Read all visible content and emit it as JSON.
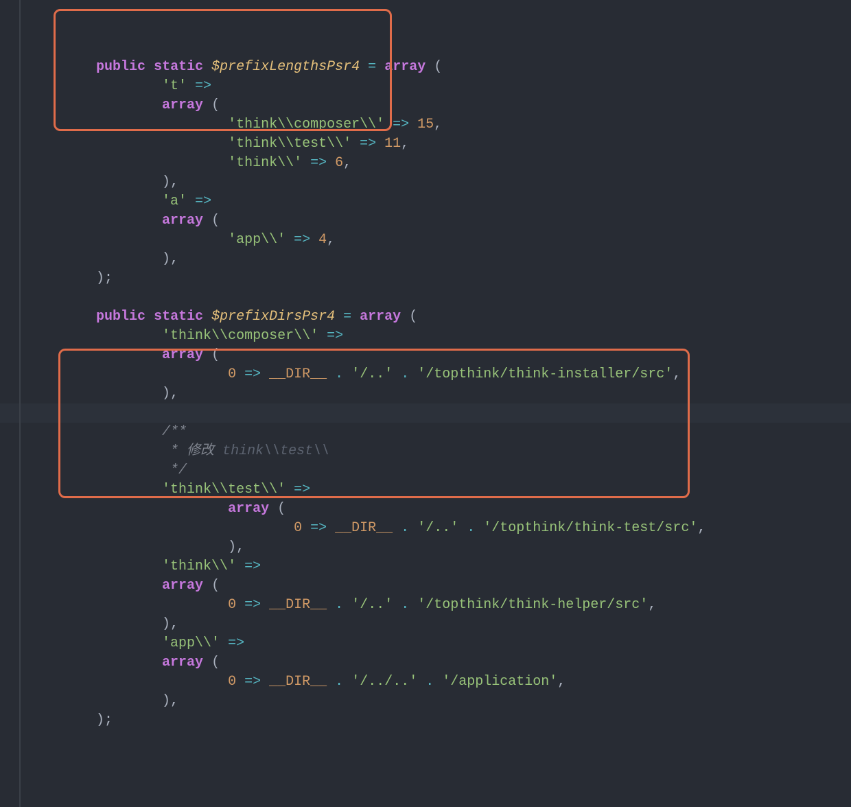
{
  "code": {
    "lines": [
      {
        "indent": 2,
        "tokens": [
          [
            "kw-public",
            "public"
          ],
          [
            "punct",
            " "
          ],
          [
            "kw-static",
            "static"
          ],
          [
            "punct",
            " "
          ],
          [
            "var",
            "$prefixLengthsPsr4"
          ],
          [
            "punct",
            " "
          ],
          [
            "op",
            "="
          ],
          [
            "punct",
            " "
          ],
          [
            "kw-array",
            "array"
          ],
          [
            "punct",
            " ("
          ]
        ]
      },
      {
        "indent": 4,
        "tokens": [
          [
            "str",
            "'t'"
          ],
          [
            "punct",
            " "
          ],
          [
            "op",
            "=>"
          ]
        ]
      },
      {
        "indent": 4,
        "tokens": [
          [
            "kw-array",
            "array"
          ],
          [
            "punct",
            " ("
          ]
        ]
      },
      {
        "indent": 6,
        "tokens": [
          [
            "str",
            "'think\\\\composer\\\\'"
          ],
          [
            "punct",
            " "
          ],
          [
            "op",
            "=>"
          ],
          [
            "punct",
            " "
          ],
          [
            "num",
            "15"
          ],
          [
            "punct",
            ","
          ]
        ]
      },
      {
        "indent": 6,
        "tokens": [
          [
            "str",
            "'think\\\\test\\\\'"
          ],
          [
            "punct",
            " "
          ],
          [
            "op",
            "=>"
          ],
          [
            "punct",
            " "
          ],
          [
            "num",
            "11"
          ],
          [
            "punct",
            ","
          ]
        ]
      },
      {
        "indent": 6,
        "tokens": [
          [
            "str",
            "'think\\\\'"
          ],
          [
            "punct",
            " "
          ],
          [
            "op",
            "=>"
          ],
          [
            "punct",
            " "
          ],
          [
            "num",
            "6"
          ],
          [
            "punct",
            ","
          ]
        ]
      },
      {
        "indent": 4,
        "tokens": [
          [
            "punct",
            ")"
          ],
          [
            "punct",
            ","
          ]
        ]
      },
      {
        "indent": 4,
        "tokens": [
          [
            "str",
            "'a'"
          ],
          [
            "punct",
            " "
          ],
          [
            "op",
            "=>"
          ]
        ]
      },
      {
        "indent": 4,
        "tokens": [
          [
            "kw-array",
            "array"
          ],
          [
            "punct",
            " ("
          ]
        ]
      },
      {
        "indent": 6,
        "tokens": [
          [
            "str",
            "'app\\\\'"
          ],
          [
            "punct",
            " "
          ],
          [
            "op",
            "=>"
          ],
          [
            "punct",
            " "
          ],
          [
            "num",
            "4"
          ],
          [
            "punct",
            ","
          ]
        ]
      },
      {
        "indent": 4,
        "tokens": [
          [
            "punct",
            ")"
          ],
          [
            "punct",
            ","
          ]
        ]
      },
      {
        "indent": 2,
        "tokens": [
          [
            "punct",
            ")"
          ],
          [
            "punct",
            ";"
          ]
        ]
      },
      {
        "indent": 0,
        "tokens": []
      },
      {
        "indent": 2,
        "tokens": [
          [
            "kw-public",
            "public"
          ],
          [
            "punct",
            " "
          ],
          [
            "kw-static",
            "static"
          ],
          [
            "punct",
            " "
          ],
          [
            "var",
            "$prefixDirsPsr4"
          ],
          [
            "punct",
            " "
          ],
          [
            "op",
            "="
          ],
          [
            "punct",
            " "
          ],
          [
            "kw-array",
            "array"
          ],
          [
            "punct",
            " ("
          ]
        ]
      },
      {
        "indent": 4,
        "tokens": [
          [
            "str",
            "'think\\\\composer\\\\'"
          ],
          [
            "punct",
            " "
          ],
          [
            "op",
            "=>"
          ]
        ]
      },
      {
        "indent": 4,
        "tokens": [
          [
            "kw-array",
            "array"
          ],
          [
            "punct",
            " ("
          ]
        ]
      },
      {
        "indent": 6,
        "tokens": [
          [
            "num",
            "0"
          ],
          [
            "punct",
            " "
          ],
          [
            "op",
            "=>"
          ],
          [
            "punct",
            " "
          ],
          [
            "const",
            "__DIR__"
          ],
          [
            "punct",
            " "
          ],
          [
            "op",
            "."
          ],
          [
            "punct",
            " "
          ],
          [
            "str",
            "'/..'"
          ],
          [
            "punct",
            " "
          ],
          [
            "op",
            "."
          ],
          [
            "punct",
            " "
          ],
          [
            "str",
            "'/topthink/think-installer/src'"
          ],
          [
            "punct",
            ","
          ]
        ]
      },
      {
        "indent": 4,
        "tokens": [
          [
            "punct",
            ")"
          ],
          [
            "punct",
            ","
          ]
        ]
      },
      {
        "indent": 0,
        "tokens": [],
        "hl": true
      },
      {
        "indent": 4,
        "tokens": [
          [
            "comment",
            "/**"
          ]
        ]
      },
      {
        "indent": 4,
        "tokens": [
          [
            "comment",
            " * 修改 "
          ],
          [
            "comment-em",
            "think\\\\test\\\\"
          ]
        ]
      },
      {
        "indent": 4,
        "tokens": [
          [
            "comment",
            " */"
          ]
        ]
      },
      {
        "indent": 4,
        "tokens": [
          [
            "str",
            "'think\\\\test\\\\'"
          ],
          [
            "punct",
            " "
          ],
          [
            "op",
            "=>"
          ]
        ]
      },
      {
        "indent": 6,
        "tokens": [
          [
            "kw-array",
            "array"
          ],
          [
            "punct",
            " ("
          ]
        ]
      },
      {
        "indent": 8,
        "tokens": [
          [
            "num",
            "0"
          ],
          [
            "punct",
            " "
          ],
          [
            "op",
            "=>"
          ],
          [
            "punct",
            " "
          ],
          [
            "const",
            "__DIR__"
          ],
          [
            "punct",
            " "
          ],
          [
            "op",
            "."
          ],
          [
            "punct",
            " "
          ],
          [
            "str",
            "'/..'"
          ],
          [
            "punct",
            " "
          ],
          [
            "op",
            "."
          ],
          [
            "punct",
            " "
          ],
          [
            "str",
            "'/topthink/think-test/src'"
          ],
          [
            "punct",
            ","
          ]
        ]
      },
      {
        "indent": 6,
        "tokens": [
          [
            "punct",
            ")"
          ],
          [
            "punct",
            ","
          ]
        ]
      },
      {
        "indent": 4,
        "tokens": [
          [
            "str",
            "'think\\\\'"
          ],
          [
            "punct",
            " "
          ],
          [
            "op",
            "=>"
          ]
        ]
      },
      {
        "indent": 4,
        "tokens": [
          [
            "kw-array",
            "array"
          ],
          [
            "punct",
            " ("
          ]
        ]
      },
      {
        "indent": 6,
        "tokens": [
          [
            "num",
            "0"
          ],
          [
            "punct",
            " "
          ],
          [
            "op",
            "=>"
          ],
          [
            "punct",
            " "
          ],
          [
            "const",
            "__DIR__"
          ],
          [
            "punct",
            " "
          ],
          [
            "op",
            "."
          ],
          [
            "punct",
            " "
          ],
          [
            "str",
            "'/..'"
          ],
          [
            "punct",
            " "
          ],
          [
            "op",
            "."
          ],
          [
            "punct",
            " "
          ],
          [
            "str",
            "'/topthink/think-helper/src'"
          ],
          [
            "punct",
            ","
          ]
        ]
      },
      {
        "indent": 4,
        "tokens": [
          [
            "punct",
            ")"
          ],
          [
            "punct",
            ","
          ]
        ]
      },
      {
        "indent": 4,
        "tokens": [
          [
            "str",
            "'app\\\\'"
          ],
          [
            "punct",
            " "
          ],
          [
            "op",
            "=>"
          ]
        ]
      },
      {
        "indent": 4,
        "tokens": [
          [
            "kw-array",
            "array"
          ],
          [
            "punct",
            " ("
          ]
        ]
      },
      {
        "indent": 6,
        "tokens": [
          [
            "num",
            "0"
          ],
          [
            "punct",
            " "
          ],
          [
            "op",
            "=>"
          ],
          [
            "punct",
            " "
          ],
          [
            "const",
            "__DIR__"
          ],
          [
            "punct",
            " "
          ],
          [
            "op",
            "."
          ],
          [
            "punct",
            " "
          ],
          [
            "str",
            "'/../..'"
          ],
          [
            "punct",
            " "
          ],
          [
            "op",
            "."
          ],
          [
            "punct",
            " "
          ],
          [
            "str",
            "'/application'"
          ],
          [
            "punct",
            ","
          ]
        ]
      },
      {
        "indent": 4,
        "tokens": [
          [
            "punct",
            ")"
          ],
          [
            "punct",
            ","
          ]
        ]
      },
      {
        "indent": 2,
        "tokens": [
          [
            "punct",
            ")"
          ],
          [
            "punct",
            ";"
          ]
        ]
      }
    ]
  },
  "annotations": {
    "box1_label": "highlighted-array-t-definition",
    "box2_label": "highlighted-think-test-block"
  }
}
